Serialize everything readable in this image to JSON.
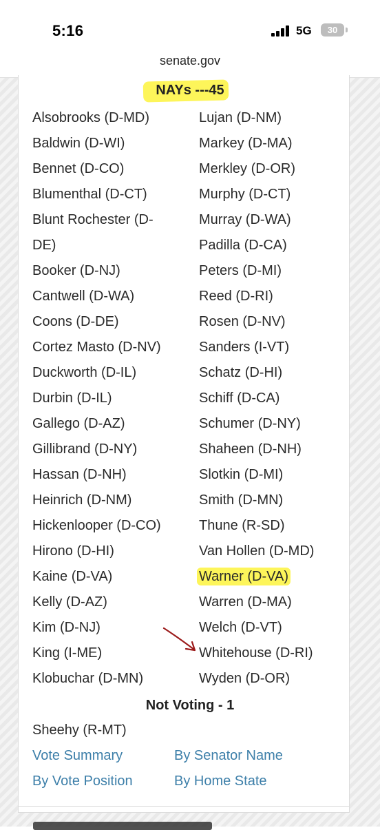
{
  "status": {
    "time": "5:16",
    "network": "5G",
    "battery": "30"
  },
  "browser": {
    "url": "senate.gov"
  },
  "nays": {
    "heading": "NAYs ---45",
    "left": [
      "Alsobrooks (D-MD)",
      "Baldwin (D-WI)",
      "Bennet (D-CO)",
      "Blumenthal (D-CT)",
      "Blunt Rochester (D-",
      "DE)",
      "Booker (D-NJ)",
      "Cantwell (D-WA)",
      "Coons (D-DE)",
      "Cortez Masto (D-NV)",
      "Duckworth (D-IL)",
      "Durbin (D-IL)",
      "Gallego (D-AZ)",
      "Gillibrand (D-NY)",
      "Hassan (D-NH)",
      "Heinrich (D-NM)",
      "Hickenlooper (D-CO)",
      "Hirono (D-HI)",
      "Kaine (D-VA)",
      "Kelly (D-AZ)",
      "Kim (D-NJ)",
      "King (I-ME)",
      "Klobuchar (D-MN)"
    ],
    "right": [
      "Lujan (D-NM)",
      "Markey (D-MA)",
      "Merkley (D-OR)",
      "Murphy (D-CT)",
      "Murray (D-WA)",
      "Padilla (D-CA)",
      "Peters (D-MI)",
      "Reed (D-RI)",
      "Rosen (D-NV)",
      "Sanders (I-VT)",
      "Schatz (D-HI)",
      "Schiff (D-CA)",
      "Schumer (D-NY)",
      "Shaheen (D-NH)",
      "Slotkin (D-MI)",
      "Smith (D-MN)",
      "Thune (R-SD)",
      "Van Hollen (D-MD)",
      "Warner (D-VA)",
      "Warren (D-MA)",
      "Welch (D-VT)",
      "Whitehouse (D-RI)",
      "Wyden (D-OR)"
    ],
    "highlighted_right_index": 18
  },
  "not_voting": {
    "heading": "Not Voting - 1",
    "names": [
      "Sheehy (R-MT)"
    ]
  },
  "links": {
    "vote_summary": "Vote Summary",
    "by_senator_name": "By Senator Name",
    "by_vote_position": "By Vote Position",
    "by_home_state": "By Home State"
  },
  "colors": {
    "highlight": "#fdf55a",
    "link": "#3d7fa9",
    "annotation_arrow": "#9b1a1a"
  }
}
